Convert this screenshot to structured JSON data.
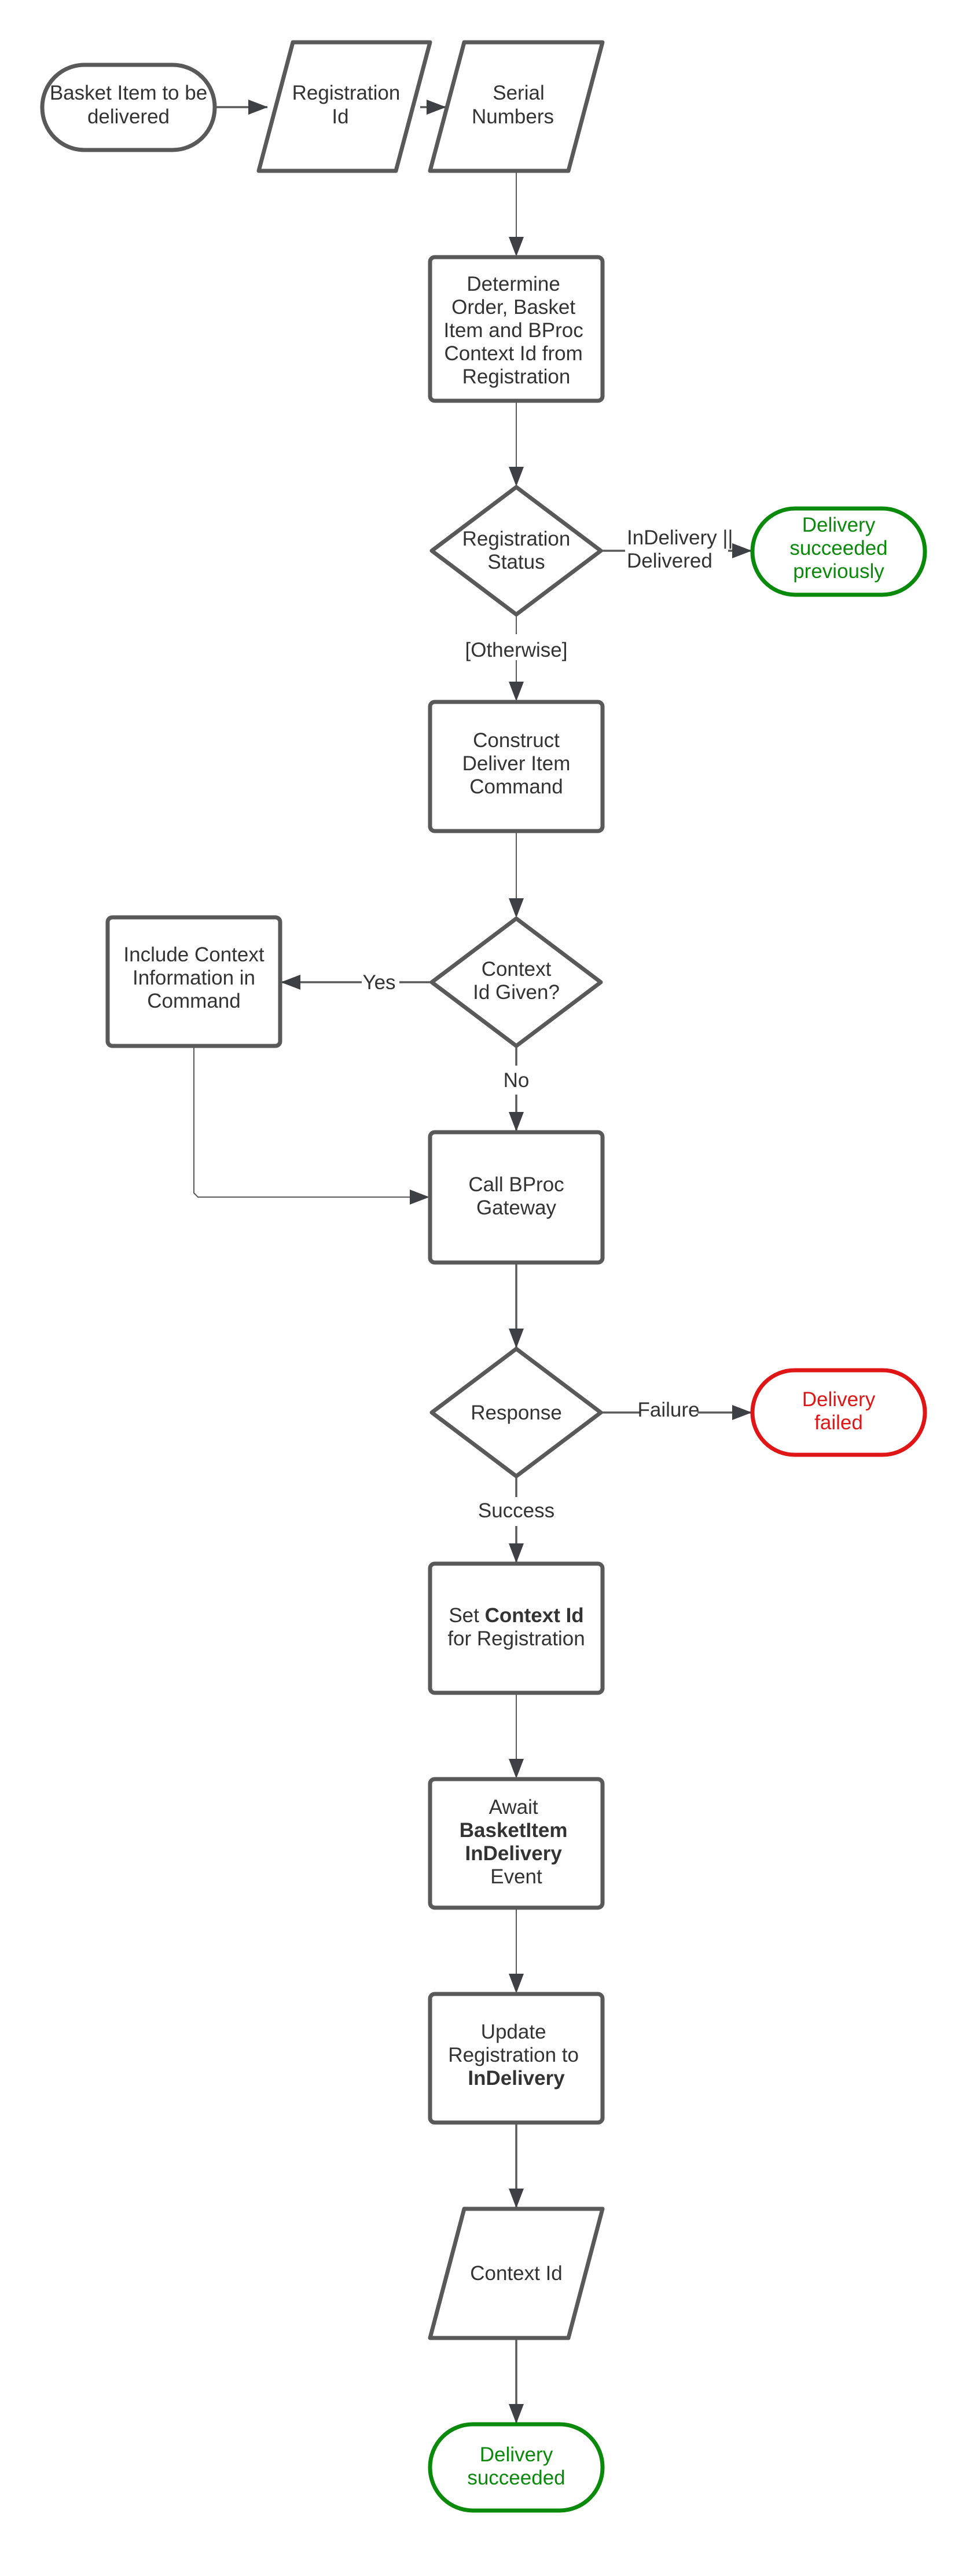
{
  "colors": {
    "stroke": "#595959",
    "success": "#0a8a0a",
    "failure": "#e01515",
    "text": "#333333"
  },
  "nodes": {
    "start": {
      "lines": [
        "Basket Item to be",
        "delivered"
      ]
    },
    "registration_id": {
      "lines": [
        "Registration",
        "Id"
      ]
    },
    "serial_numbers": {
      "lines": [
        "Serial",
        "Numbers"
      ]
    },
    "determine": {
      "lines": [
        "Determine",
        "Order, Basket",
        "Item and BProc",
        "Context Id from",
        "Registration"
      ]
    },
    "registration_status": {
      "lines": [
        "Registration",
        "Status"
      ]
    },
    "succeeded_previously": {
      "lines": [
        "Delivery",
        "succeeded",
        "previously"
      ]
    },
    "construct": {
      "lines": [
        "Construct",
        "Deliver Item",
        "Command"
      ]
    },
    "context_given": {
      "lines": [
        "Context",
        "Id Given?"
      ]
    },
    "include_context": {
      "lines": [
        "Include Context",
        "Information in",
        "Command"
      ]
    },
    "call_gateway": {
      "lines": [
        "Call BProc",
        "Gateway"
      ]
    },
    "response": {
      "lines": [
        "Response"
      ]
    },
    "failed": {
      "lines": [
        "Delivery",
        "failed"
      ]
    },
    "set_context": {
      "line1_prefix": "Set ",
      "line1_bold": "Context Id",
      "line2": "for Registration"
    },
    "await": {
      "line1": "Await",
      "line2_bold": "BasketItem",
      "line3_bold": "InDelivery",
      "line4": "Event"
    },
    "update": {
      "line1": "Update",
      "line2": "Registration to",
      "line3_bold": "InDelivery"
    },
    "context_id_output": {
      "lines": [
        "Context Id"
      ]
    },
    "succeeded": {
      "lines": [
        "Delivery",
        "succeeded"
      ]
    }
  },
  "edge_labels": {
    "indelivery": [
      "InDelivery ||",
      "Delivered"
    ],
    "otherwise": "[Otherwise]",
    "yes": "Yes",
    "no": "No",
    "failure": "Failure",
    "success": "Success"
  }
}
